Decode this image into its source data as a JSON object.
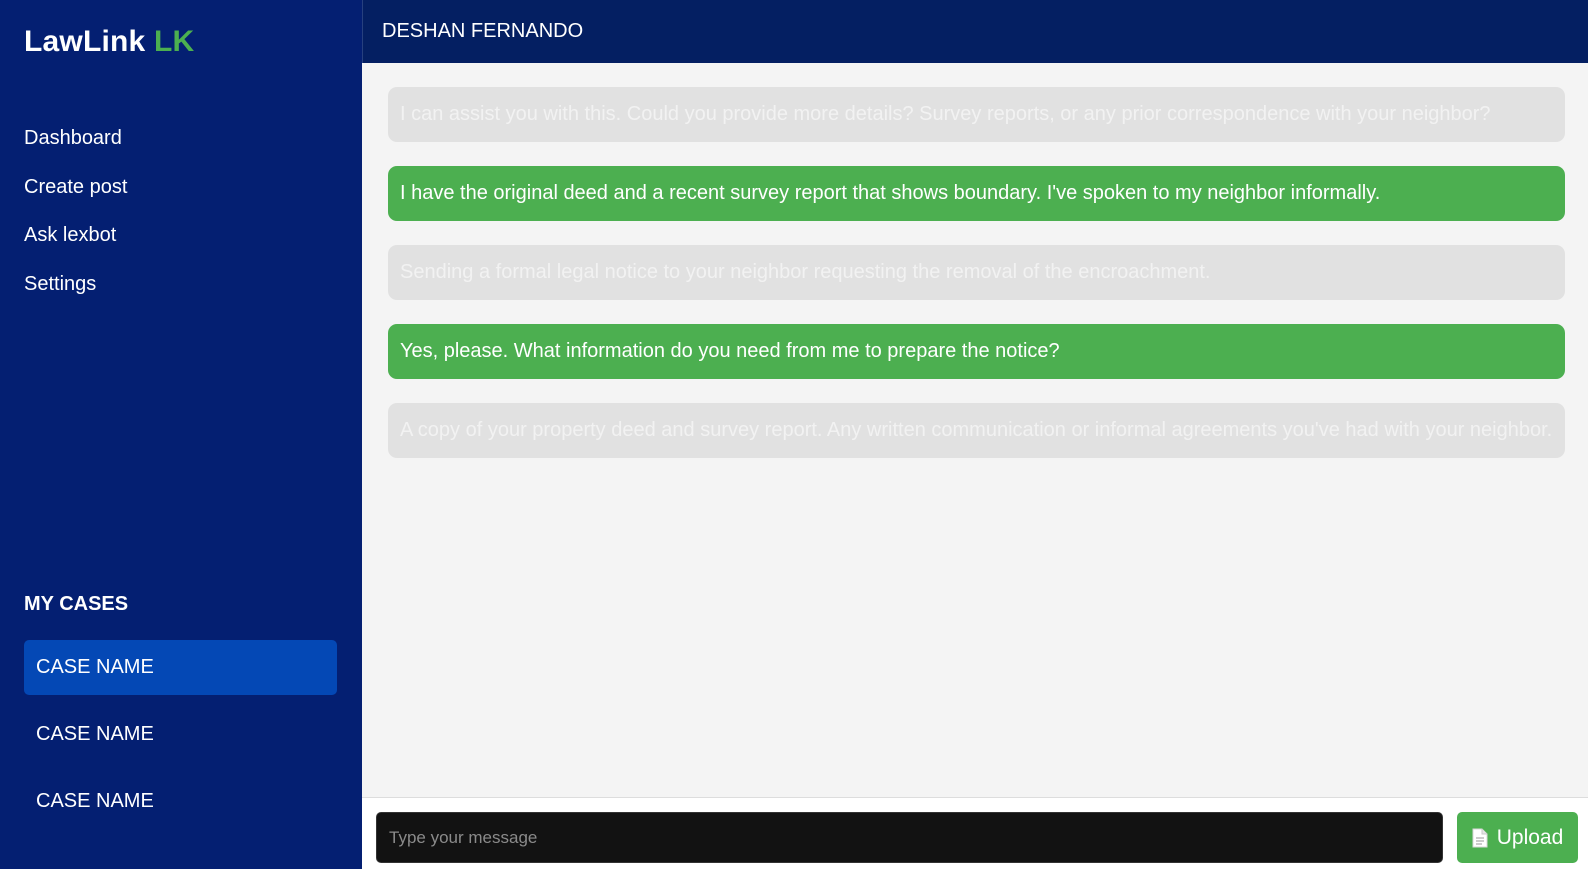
{
  "brand": {
    "name": "LawLink",
    "suffix": "LK",
    "accent_color": "#4caf50"
  },
  "nav": [
    "Dashboard",
    "Create post",
    "Ask lexbot",
    "Settings"
  ],
  "cases": {
    "title": "MY CASES",
    "items": [
      "CASE NAME",
      "CASE NAME",
      "CASE NAME"
    ],
    "active_index": 0
  },
  "header": {
    "title": "DESHAN FERNANDO"
  },
  "messages": [
    {
      "sender": "bot",
      "text": "I can assist you with this. Could you provide more details? Survey reports, or any prior correspondence with your neighbor?"
    },
    {
      "sender": "user",
      "text": "I have the original deed and a recent survey report that shows boundary. I've spoken to my neighbor informally."
    },
    {
      "sender": "bot",
      "text": "Sending a formal legal notice to your neighbor requesting the removal of the encroachment."
    },
    {
      "sender": "user",
      "text": "Yes, please. What information do you need from me to prepare the notice?"
    },
    {
      "sender": "bot",
      "text": "A copy of your property deed and survey report. Any written communication or informal agreements you've had with your neighbor."
    }
  ],
  "composer": {
    "placeholder": "Type your message",
    "value": "",
    "upload_label": "Upload",
    "upload_icon": "document-icon"
  },
  "colors": {
    "sidebar_bg": "#041f72",
    "header_bg": "#041f62",
    "active_case_bg": "#0448b5",
    "user_bubble": "#4caf50",
    "bot_bubble": "#e1e1e1"
  }
}
